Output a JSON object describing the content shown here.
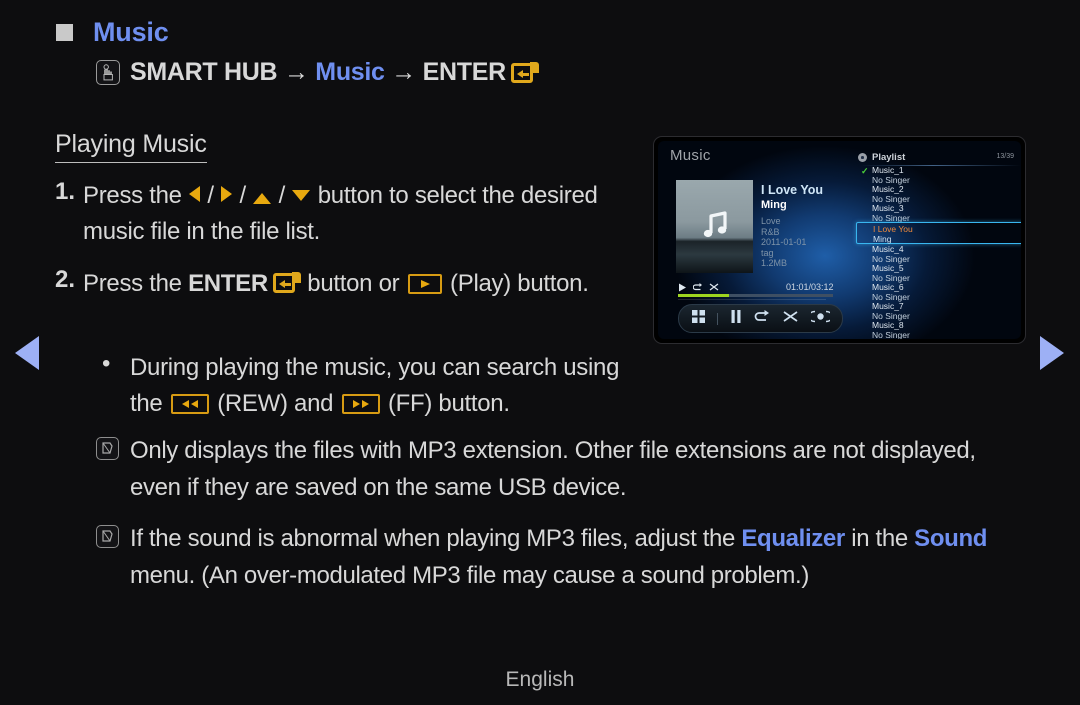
{
  "header": {
    "title": "Music",
    "path": {
      "smart_hub": "SMART HUB",
      "arrow1": " → ",
      "music": "Music",
      "arrow2": " → ",
      "enter": "ENTER",
      "hub_icon": "smart-hub-hand-icon",
      "enter_icon": "enter-key-icon"
    }
  },
  "section": {
    "title": "Playing Music",
    "steps": [
      {
        "number": "1.",
        "part1": "Press the ",
        "part2": " button to select the desired music file in the file list.",
        "icons": [
          "arrow-left-icon",
          "arrow-right-icon",
          "arrow-up-icon",
          "arrow-down-icon"
        ],
        "separator": "/"
      },
      {
        "number": "2.",
        "part1": "Press the ",
        "enter_label": "ENTER",
        "part2": " button or ",
        "part3": " (Play) button.",
        "icons": [
          "enter-key-icon",
          "play-key-icon"
        ]
      }
    ],
    "bullets": [
      {
        "marker": "•",
        "part1": "During playing the music, you can search using the ",
        "rew_label": " (REW) and ",
        "ff_label": " (FF) button.",
        "icons": [
          "rewind-key-icon",
          "fast-forward-key-icon"
        ]
      }
    ],
    "notes": [
      {
        "icon": "note-pencil-icon",
        "text": "Only displays the files with MP3 extension. Other file extensions are not displayed, even if they are saved on the same USB device."
      },
      {
        "icon": "note-pencil-icon",
        "pre": "If the sound is abnormal when playing MP3 files, adjust the ",
        "highlight1": "Equalizer",
        "mid": " in the ",
        "highlight2": "Sound",
        "post": " menu. (An over-modulated MP3 file may cause a sound problem.)"
      }
    ]
  },
  "nav": {
    "prev": "previous-page-arrow",
    "next": "next-page-arrow"
  },
  "footer": {
    "language": "English"
  },
  "tv_preview": {
    "screen_title": "Music",
    "playlist_label": "Playlist",
    "playlist_count": "13/39",
    "now_playing": {
      "title": "I Love You",
      "artist": "Ming",
      "album": "Love",
      "genre": "R&B",
      "date": "2011-01-01",
      "tag": "tag",
      "size": "1.2MB",
      "time": "01:01/03:12",
      "progress_percent": 33
    },
    "mini_icons": [
      "play-icon",
      "repeat-icon",
      "shuffle-icon"
    ],
    "control_icons": [
      "grid-view-icon",
      "pause-icon",
      "repeat-icon",
      "shuffle-icon",
      "record-icon"
    ],
    "playlist": [
      {
        "name": "Music_1",
        "singer": "No Singer",
        "checked": true,
        "selected": false
      },
      {
        "name": "Music_2",
        "singer": "No Singer",
        "checked": false,
        "selected": false
      },
      {
        "name": "Music_3",
        "singer": "No Singer",
        "checked": false,
        "selected": false
      },
      {
        "name": "I Love You",
        "singer": "Ming",
        "checked": false,
        "selected": true
      },
      {
        "name": "Music_4",
        "singer": "No Singer",
        "checked": false,
        "selected": false
      },
      {
        "name": "Music_5",
        "singer": "No Singer",
        "checked": false,
        "selected": false
      },
      {
        "name": "Music_6",
        "singer": "No Singer",
        "checked": false,
        "selected": false
      },
      {
        "name": "Music_7",
        "singer": "No Singer",
        "checked": false,
        "selected": false
      },
      {
        "name": "Music_8",
        "singer": "No Singer",
        "checked": false,
        "selected": false
      }
    ],
    "check_glyph": "✓"
  },
  "colors": {
    "accent_blue": "#6f8ff0",
    "key_gold": "#e0a81c",
    "text": "#d8d8d8",
    "background": "#0d0d0f",
    "selection_blue": "#39b6ef",
    "selected_track": "#f08a3c"
  }
}
